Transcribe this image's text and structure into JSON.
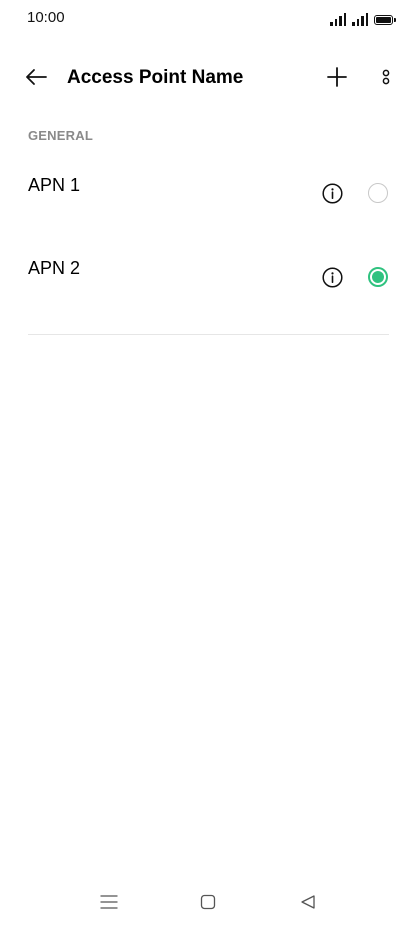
{
  "status_bar": {
    "time": "10:00",
    "icons": [
      "signal-icon",
      "signal-icon",
      "battery-icon"
    ]
  },
  "app_bar": {
    "back_icon": "arrow-left-icon",
    "title": "Access Point Name",
    "add_icon": "plus-icon",
    "more_icon": "more-vertical-icon"
  },
  "section": {
    "header": "GENERAL"
  },
  "apns": [
    {
      "name": "APN 1",
      "selected": false,
      "info_icon": "info-icon"
    },
    {
      "name": "APN 2",
      "selected": true,
      "info_icon": "info-icon"
    }
  ],
  "nav_bar": {
    "icons": [
      "menu-icon",
      "home-icon",
      "back-triangle-icon"
    ]
  },
  "colors": {
    "accent": "#2fc27f",
    "section_header": "#8a8a8a",
    "divider": "#e6e6e6"
  }
}
